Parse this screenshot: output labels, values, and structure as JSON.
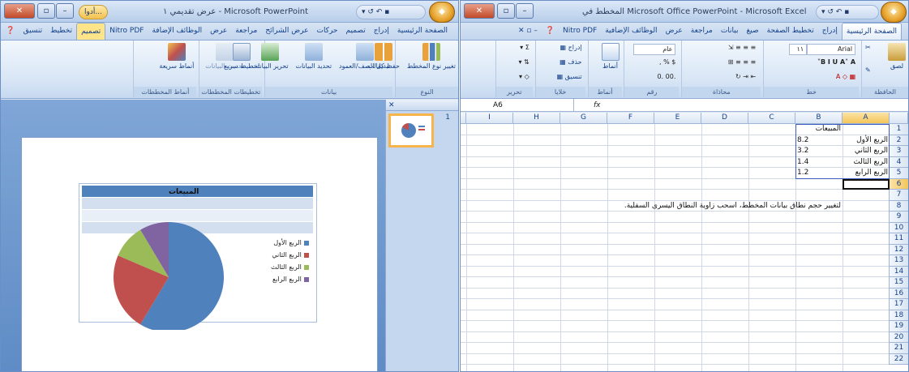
{
  "ppt": {
    "title": "عرض تقديمي ١ - Microsoft PowerPoint",
    "chart_tools_tab": "أدوا...",
    "tabs": [
      "الصفحة الرئيسية",
      "إدراج",
      "تصميم",
      "حركات",
      "عرض الشرائح",
      "مراجعة",
      "عرض",
      "الوظائف الإضافة",
      "Nitro PDF",
      "تصميم",
      "تخطيط",
      "تنسيق"
    ],
    "ribbon_groups": [
      {
        "label": "النوع",
        "buttons": [
          "تغيير نوع المخطط",
          "حفظ كقالب"
        ]
      },
      {
        "label": "بيانات",
        "buttons": [
          "تبديل الصف/العمود",
          "تحديد البيانات",
          "تحرير البيانات",
          "تحديث البيانات"
        ]
      },
      {
        "label": "تخطيطات المخططات",
        "buttons": [
          "تخطيط سريع"
        ]
      },
      {
        "label": "أنماط المخططات",
        "buttons": [
          "أنماط سريعة"
        ]
      }
    ],
    "thumb_num": "1",
    "slide_chart": {
      "title": "المبيعات",
      "legend": [
        {
          "label": "الربع الأول",
          "color": "#4f81bd"
        },
        {
          "label": "الربع الثاني",
          "color": "#c0504d"
        },
        {
          "label": "الربع الثالث",
          "color": "#9bbb59"
        },
        {
          "label": "الربع الرابع",
          "color": "#8064a2"
        }
      ]
    }
  },
  "xl": {
    "title": "المخطط في Microsoft Office PowerPoint - Microsoft Excel",
    "tabs": [
      "الصفحة الرئيسية",
      "إدراج",
      "تخطيط الصفحة",
      "صيغ",
      "بيانات",
      "مراجعة",
      "عرض",
      "الوظائف الإضافية",
      "Nitro PDF"
    ],
    "ribbon_groups": [
      {
        "label": "الحافظة",
        "buttons": [
          "لصق"
        ]
      },
      {
        "label": "خط",
        "font": "Arial",
        "size": "١١"
      },
      {
        "label": "محاذاة"
      },
      {
        "label": "رقم",
        "format": "عام"
      },
      {
        "label": "أنماط",
        "buttons": [
          "أنماط"
        ]
      },
      {
        "label": "خلايا",
        "buttons": [
          "إدراج",
          "حذف",
          "تنسيق"
        ]
      },
      {
        "label": "تحرير"
      }
    ],
    "name_box": "A6",
    "fx": "fx",
    "columns": [
      "A",
      "B",
      "C",
      "D",
      "E",
      "F",
      "G",
      "H",
      "I"
    ],
    "rows": [
      "1",
      "2",
      "3",
      "4",
      "5",
      "6",
      "7",
      "8",
      "9",
      "10",
      "11",
      "12",
      "13",
      "14",
      "15",
      "16",
      "17",
      "18",
      "19",
      "20",
      "21",
      "22"
    ],
    "header_b1": "المبيعات",
    "categories": [
      "الربع الأول",
      "الربع الثاني",
      "الربع الثالث",
      "الربع الرابع"
    ],
    "values": [
      "8.2",
      "3.2",
      "1.4",
      "1.2"
    ],
    "note": "لتغيير حجم نطاق بيانات المخطط، اسحب زاوية النطاق اليسرى السفلية."
  },
  "chart_data": {
    "type": "pie",
    "title": "المبيعات",
    "categories": [
      "الربع الأول",
      "الربع الثاني",
      "الربع الثالث",
      "الربع الرابع"
    ],
    "values": [
      8.2,
      3.2,
      1.4,
      1.2
    ],
    "colors": [
      "#4f81bd",
      "#c0504d",
      "#9bbb59",
      "#8064a2"
    ],
    "legend_position": "right"
  }
}
